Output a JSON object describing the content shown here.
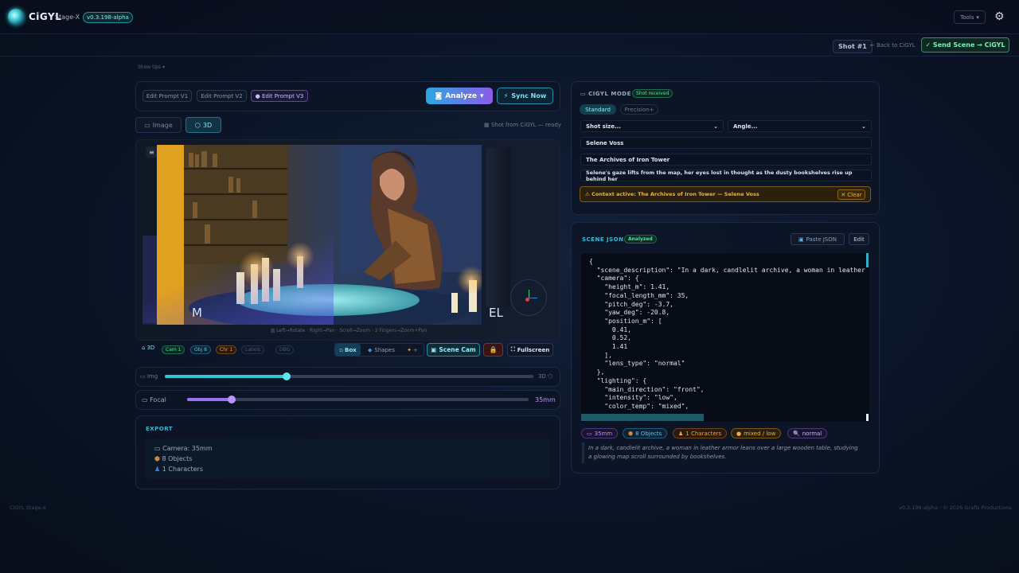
{
  "app": {
    "name": "CiGYL",
    "stage": "Stage-X",
    "version": "v0.3.198-alpha"
  },
  "topbar": {
    "tools_label": "Tools",
    "gear_icon": "gear-icon"
  },
  "shotbar": {
    "shot": "Shot #1",
    "back": "← Back to CiGYL",
    "send": "✓ Send Scene → CiGYL"
  },
  "showtips": "Show tips ▾",
  "prompts": {
    "v1": "Edit Prompt V1",
    "v2": "Edit Prompt V2",
    "v3": "● Edit Prompt V3"
  },
  "analyze": "Analyze",
  "sync": "Sync Now",
  "viewtabs": {
    "image": "Image",
    "threed": "3D",
    "status": "Shot from CiGYL — ready"
  },
  "viewport": {
    "overlay_left": "M",
    "overlay_right": "EL",
    "hint": "Left→Rotate · Right→Pan · Scroll→Zoom · 2 Fingers→Zoom+Pan"
  },
  "toolbar": {
    "mode": "3D",
    "cam": "Cam 1",
    "obj": "Obj 8",
    "chr": "Chr 1",
    "labels": "Labels",
    "dbg": "DBG",
    "box": "Box",
    "shapes": "Shapes",
    "plus": "+",
    "scenecam": "Scene Cam",
    "fullscreen": "Fullscreen"
  },
  "img3d": {
    "left": "Img",
    "right": "3D",
    "value": 0.33
  },
  "focal": {
    "label": "Focal",
    "value": "35mm",
    "position": 0.13
  },
  "export": {
    "title": "EXPORT",
    "camera": "Camera: 35mm",
    "objects": "8 Objects",
    "characters": "1 Characters"
  },
  "cigyl": {
    "title": "CIGYL MODE",
    "status": "Shot received",
    "mode_standard": "Standard",
    "mode_precision": "Precision+",
    "shot_size": "Shot size...",
    "angle": "Angle...",
    "character": "Selene Voss",
    "location": "The Archives of Iron Tower",
    "description": "Selene's gaze lifts from the map, her eyes lost in thought as the dusty bookshelves rise up behind her",
    "context": "Context active: The Archives of Iron Tower — Selene Voss",
    "clear": "Clear"
  },
  "scenejson": {
    "title": "SCENE JSON",
    "status": "Analyzed",
    "paste": "Paste JSON",
    "edit": "Edit",
    "code": "{\n  \"scene_description\": \"In a dark, candlelit archive, a woman in leather\n  \"camera\": {\n    \"height_m\": 1.41,\n    \"focal_length_mm\": 35,\n    \"pitch_deg\": -3.7,\n    \"yaw_deg\": -20.8,\n    \"position_m\": [\n      0.41,\n      0.52,\n      1.41\n    ],\n    \"lens_type\": \"normal\"\n  },\n  \"lighting\": {\n    \"main_direction\": \"front\",\n    \"intensity\": \"low\",\n    \"color_temp\": \"mixed\","
  },
  "chips": {
    "lens": "35mm",
    "objects": "8 Objects",
    "characters": "1 Characters",
    "light": "mixed / low",
    "type": "normal"
  },
  "summary": "In a dark, candlelit archive, a woman in leather armor leans over a large wooden table, studying a glowing map scroll surrounded by bookshelves.",
  "footer": {
    "left": "CiGYL Stage-X",
    "right": "v0.3.198-alpha · © 2026 Grafis Productions"
  },
  "colors": {
    "accent": "#2fd0dc",
    "green": "#3ee08a",
    "amber": "#e0a030",
    "purple": "#a070f0"
  }
}
